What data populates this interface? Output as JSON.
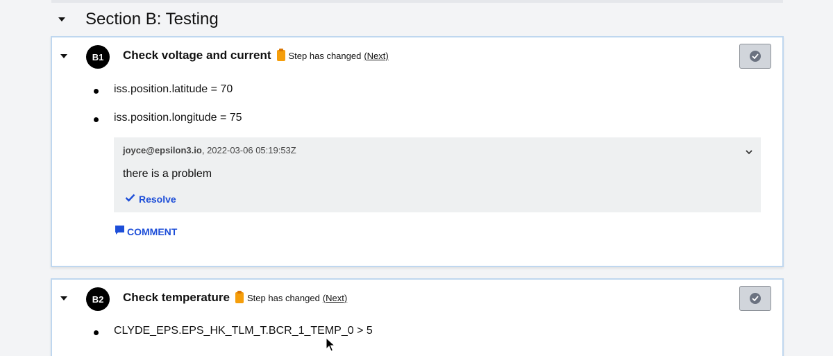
{
  "section": {
    "title": "Section B: Testing"
  },
  "steps": [
    {
      "badge": "B1",
      "title": "Check voltage and current",
      "changed_text": "Step has changed",
      "next_label": "(Next)",
      "items": [
        "iss.position.latitude = 70",
        "iss.position.longitude = 75"
      ],
      "comment": {
        "author": "joyce@epsilon3.io",
        "separator": ",",
        "timestamp": "2022-03-06 05:19:53Z",
        "body": "there is a problem",
        "resolve_label": "Resolve"
      },
      "comment_button_label": "COMMENT"
    },
    {
      "badge": "B2",
      "title": "Check temperature",
      "changed_text": "Step has changed",
      "next_label": "(Next)",
      "items": [
        "CLYDE_EPS.EPS_HK_TLM_T.BCR_1_TEMP_0 > 5"
      ]
    }
  ],
  "colors": {
    "accent_blue": "#1d4ed8",
    "card_border": "#bfd7ef",
    "changed_icon": "#f59e0b",
    "comment_bg": "#eef0f1"
  },
  "icons": {
    "section_toggle": "caret-down-icon",
    "changed": "clipboard-icon",
    "complete": "check-circle-icon",
    "comment_menu": "chevron-down-icon",
    "resolve": "checkmark-icon",
    "comment": "speech-bubble-icon"
  }
}
